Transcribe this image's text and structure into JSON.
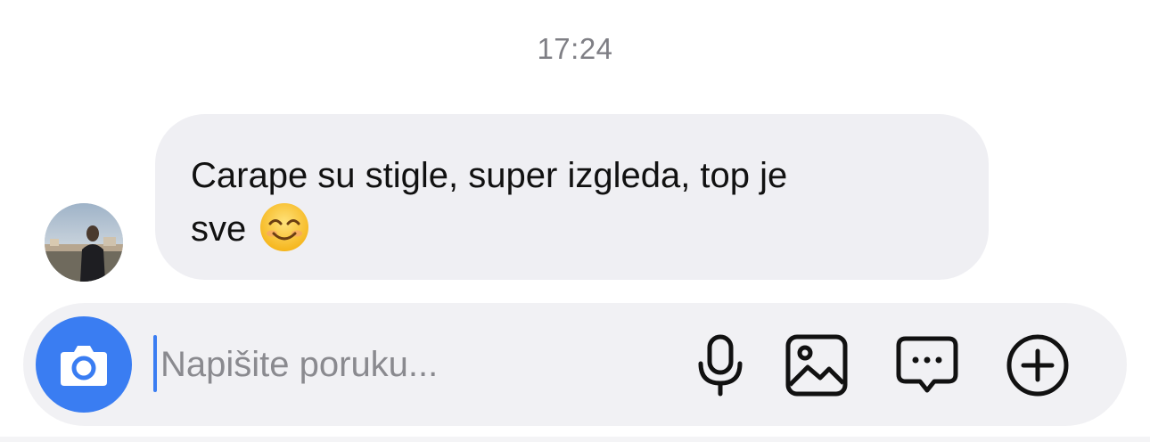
{
  "thread": {
    "timestamp": "17:24"
  },
  "message": {
    "text": "Carape su stigle, super izgleda, top je",
    "text_line2": "sve",
    "emoji": "smiling-face-with-smiling-eyes"
  },
  "composer": {
    "placeholder": "Napišite poruku...",
    "value": ""
  },
  "icons": {
    "camera": "camera-icon",
    "microphone": "microphone-icon",
    "gallery": "image-icon",
    "sticker": "chat-bubble-icon",
    "add": "plus-circle-icon"
  },
  "colors": {
    "accent": "#3a7df2",
    "bubble": "#efeff3",
    "composer": "#f1f1f4",
    "timestamp": "#7f7f85"
  }
}
